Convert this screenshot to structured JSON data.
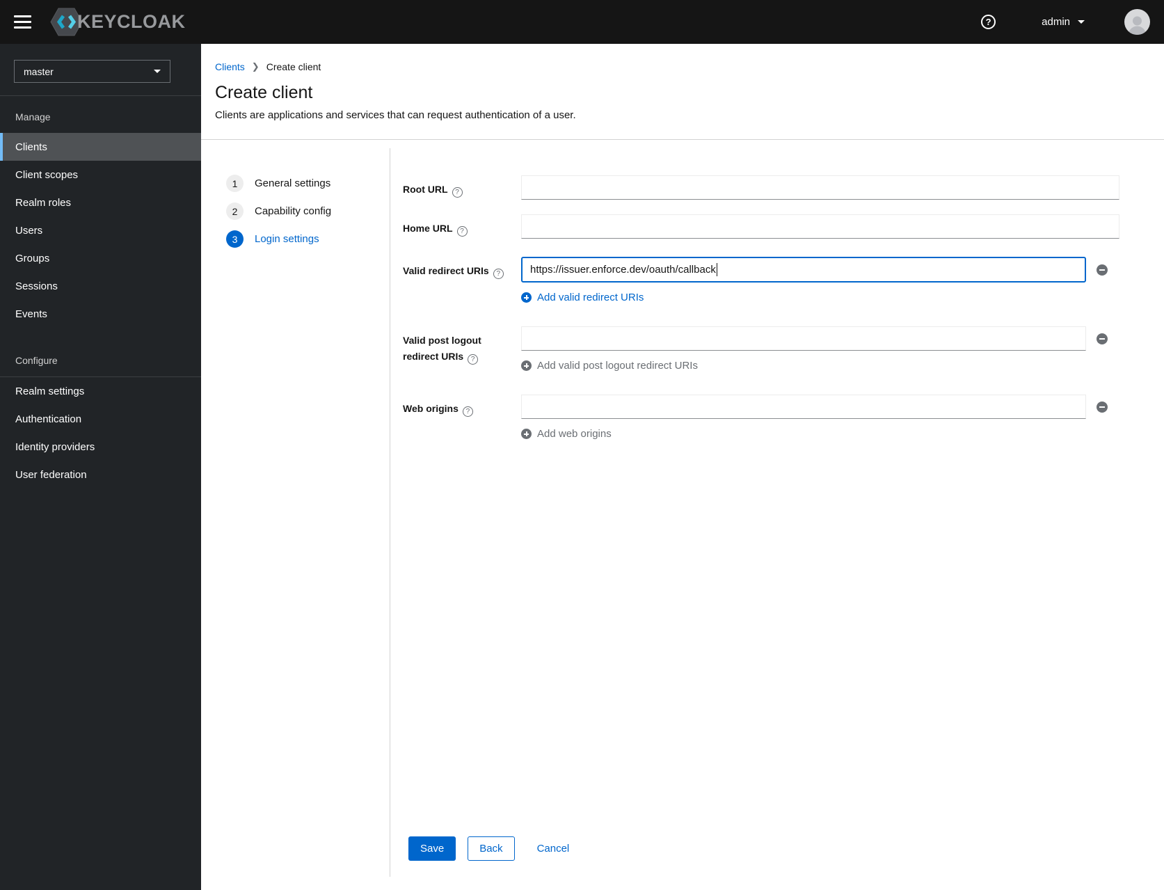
{
  "masthead": {
    "brand": "KEYCLOAK",
    "user": "admin"
  },
  "icons": {
    "question_glyph": "?",
    "nav_toggle": "hamburger",
    "user_caret": "chevron-down",
    "remove": "minus-circle",
    "add": "plus-circle"
  },
  "sidebar": {
    "realm": "master",
    "groups": [
      {
        "label": "Manage",
        "items": [
          {
            "label": "Clients",
            "selected": true
          },
          {
            "label": "Client scopes",
            "selected": false
          },
          {
            "label": "Realm roles",
            "selected": false
          },
          {
            "label": "Users",
            "selected": false
          },
          {
            "label": "Groups",
            "selected": false
          },
          {
            "label": "Sessions",
            "selected": false
          },
          {
            "label": "Events",
            "selected": false
          }
        ]
      },
      {
        "label": "Configure",
        "items": [
          {
            "label": "Realm settings",
            "selected": false
          },
          {
            "label": "Authentication",
            "selected": false
          },
          {
            "label": "Identity providers",
            "selected": false
          },
          {
            "label": "User federation",
            "selected": false
          }
        ]
      }
    ]
  },
  "page": {
    "breadcrumb": {
      "parent": "Clients",
      "current": "Create client"
    },
    "title": "Create client",
    "description": "Clients are applications and services that can request authentication of a user."
  },
  "wizard": {
    "steps": [
      {
        "num": "1",
        "label": "General settings",
        "active": false
      },
      {
        "num": "2",
        "label": "Capability config",
        "active": false
      },
      {
        "num": "3",
        "label": "Login settings",
        "active": true
      }
    ]
  },
  "form": {
    "root_url": {
      "label": "Root URL",
      "value": ""
    },
    "home_url": {
      "label": "Home URL",
      "value": ""
    },
    "valid_redirect": {
      "label": "Valid redirect URIs",
      "value": "https://issuer.enforce.dev/oauth/callback",
      "add_label": "Add valid redirect URIs"
    },
    "post_logout": {
      "label": "Valid post logout redirect URIs",
      "value": "",
      "add_label": "Add valid post logout redirect URIs"
    },
    "web_origins": {
      "label": "Web origins",
      "value": "",
      "add_label": "Add web origins"
    }
  },
  "actions": {
    "save": "Save",
    "back": "Back",
    "cancel": "Cancel"
  },
  "colors": {
    "primary": "#0066cc",
    "masthead_bg": "#151515",
    "sidebar_bg": "#212427",
    "nav_selected_bg": "#4f5255",
    "nav_selected_border": "#73bcf7",
    "muted_text": "#6a6e73",
    "divider": "#d2d2d2",
    "brand_cyan": "#2db3d4"
  }
}
